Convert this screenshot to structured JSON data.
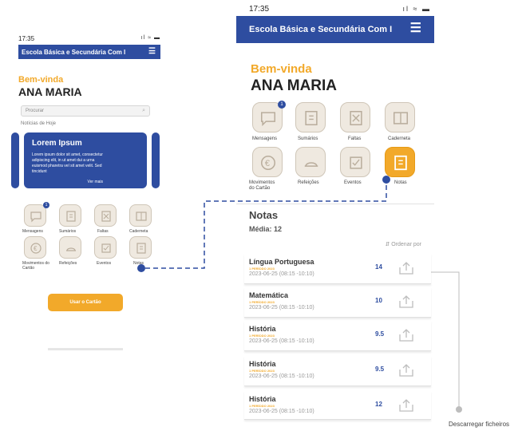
{
  "status": {
    "time": "17:35",
    "icons": "ıl ≈ ▬"
  },
  "app": {
    "title": "Escola Básica e Secundária Com I",
    "welcome": "Bem-vinda",
    "user_name": "ANA MARIA",
    "search_placeholder": "Procurar",
    "news_label": "Notícias de Hoje",
    "news_card": {
      "title": "Lorem Ipsum",
      "body": "Lorem ipsum dolor sit amet, consectetur adipiscing elit, in ut amet dui a urna euismod pharetra vel sit amet velit. Sed tincidunt",
      "more": "Ver mais"
    },
    "cta_label": "Usar o Cartão"
  },
  "menu": {
    "mensagens": "Mensagens",
    "mensagens_badge": "1",
    "sumarios": "Sumários",
    "faltas": "Faltas",
    "caderneta": "Caderneta",
    "movimentos": "Movimentos do Cartão",
    "refeicoes": "Refeições",
    "eventos": "Eventos",
    "notas": "Notas"
  },
  "notas": {
    "title": "Notas",
    "media": "Média: 12",
    "sort_label": "Ordenar por",
    "rows": [
      {
        "subject": "Língua Portuguesa",
        "period": "1 PERÍODO 2023",
        "date": "2023-06-25 (08:15 -10:10)",
        "grade": "14"
      },
      {
        "subject": "Matemática",
        "period": "1 PERÍODO 2023",
        "date": "2023-06-25 (08:15 -10:10)",
        "grade": "10"
      },
      {
        "subject": "História",
        "period": "1 PERÍODO 2023",
        "date": "2023-06-25 (08:15 -10:10)",
        "grade": "9.5"
      },
      {
        "subject": "História",
        "period": "1 PERÍODO 2023",
        "date": "2023-06-25 (08:15 -10:10)",
        "grade": "9.5"
      },
      {
        "subject": "História",
        "period": "1 PERÍODO 2023",
        "date": "2023-06-25 (08:15 -10:10)",
        "grade": "12"
      }
    ]
  },
  "annotation": {
    "download_files": "Descarregar ficheiros"
  },
  "colors": {
    "primary": "#2e4da0",
    "accent": "#f2a92a",
    "tile_bg": "#efe9e0"
  }
}
